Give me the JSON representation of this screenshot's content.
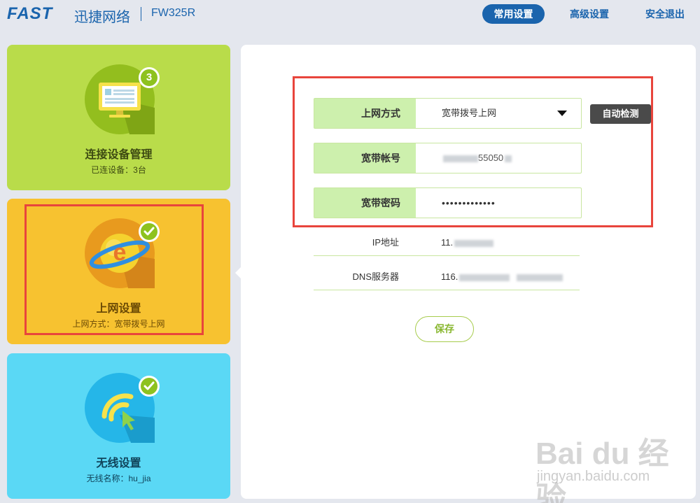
{
  "header": {
    "brand": "FAST",
    "brand_cn": "迅捷网络",
    "model": "FW325R",
    "nav": [
      {
        "label": "常用设置",
        "active": true
      },
      {
        "label": "高级设置",
        "active": false
      },
      {
        "label": "安全退出",
        "active": false
      }
    ]
  },
  "cards": {
    "devices": {
      "title": "连接设备管理",
      "subtitle": "已连设备：3台",
      "badge": "3",
      "icon": "monitor-icon"
    },
    "internet": {
      "title": "上网设置",
      "subtitle": "上网方式：宽带拨号上网",
      "icon": "globe-e-icon"
    },
    "wireless": {
      "title": "无线设置",
      "subtitle": "无线名称：hu_jia",
      "icon": "wifi-icon"
    }
  },
  "form": {
    "connection_type": {
      "label": "上网方式",
      "value": "宽带拨号上网"
    },
    "account": {
      "label": "宽带帐号",
      "value_visible": "55050"
    },
    "password": {
      "label": "宽带密码",
      "value": "•••••••••••••"
    },
    "auto_detect_label": "自动检测",
    "ip": {
      "label": "IP地址",
      "value_prefix": "11."
    },
    "dns": {
      "label": "DNS服务器",
      "value_prefix": "116."
    },
    "save_label": "保存"
  },
  "watermark": {
    "text": "Bai du 经验",
    "sub": "jingyan.baidu.com"
  },
  "colors": {
    "brand_blue": "#1a64ad",
    "card_green": "#b9dc4a",
    "card_yellow": "#f7c230",
    "card_cyan": "#5ad8f5",
    "label_green": "#cdf0ad",
    "highlight_red": "#e8453c"
  }
}
